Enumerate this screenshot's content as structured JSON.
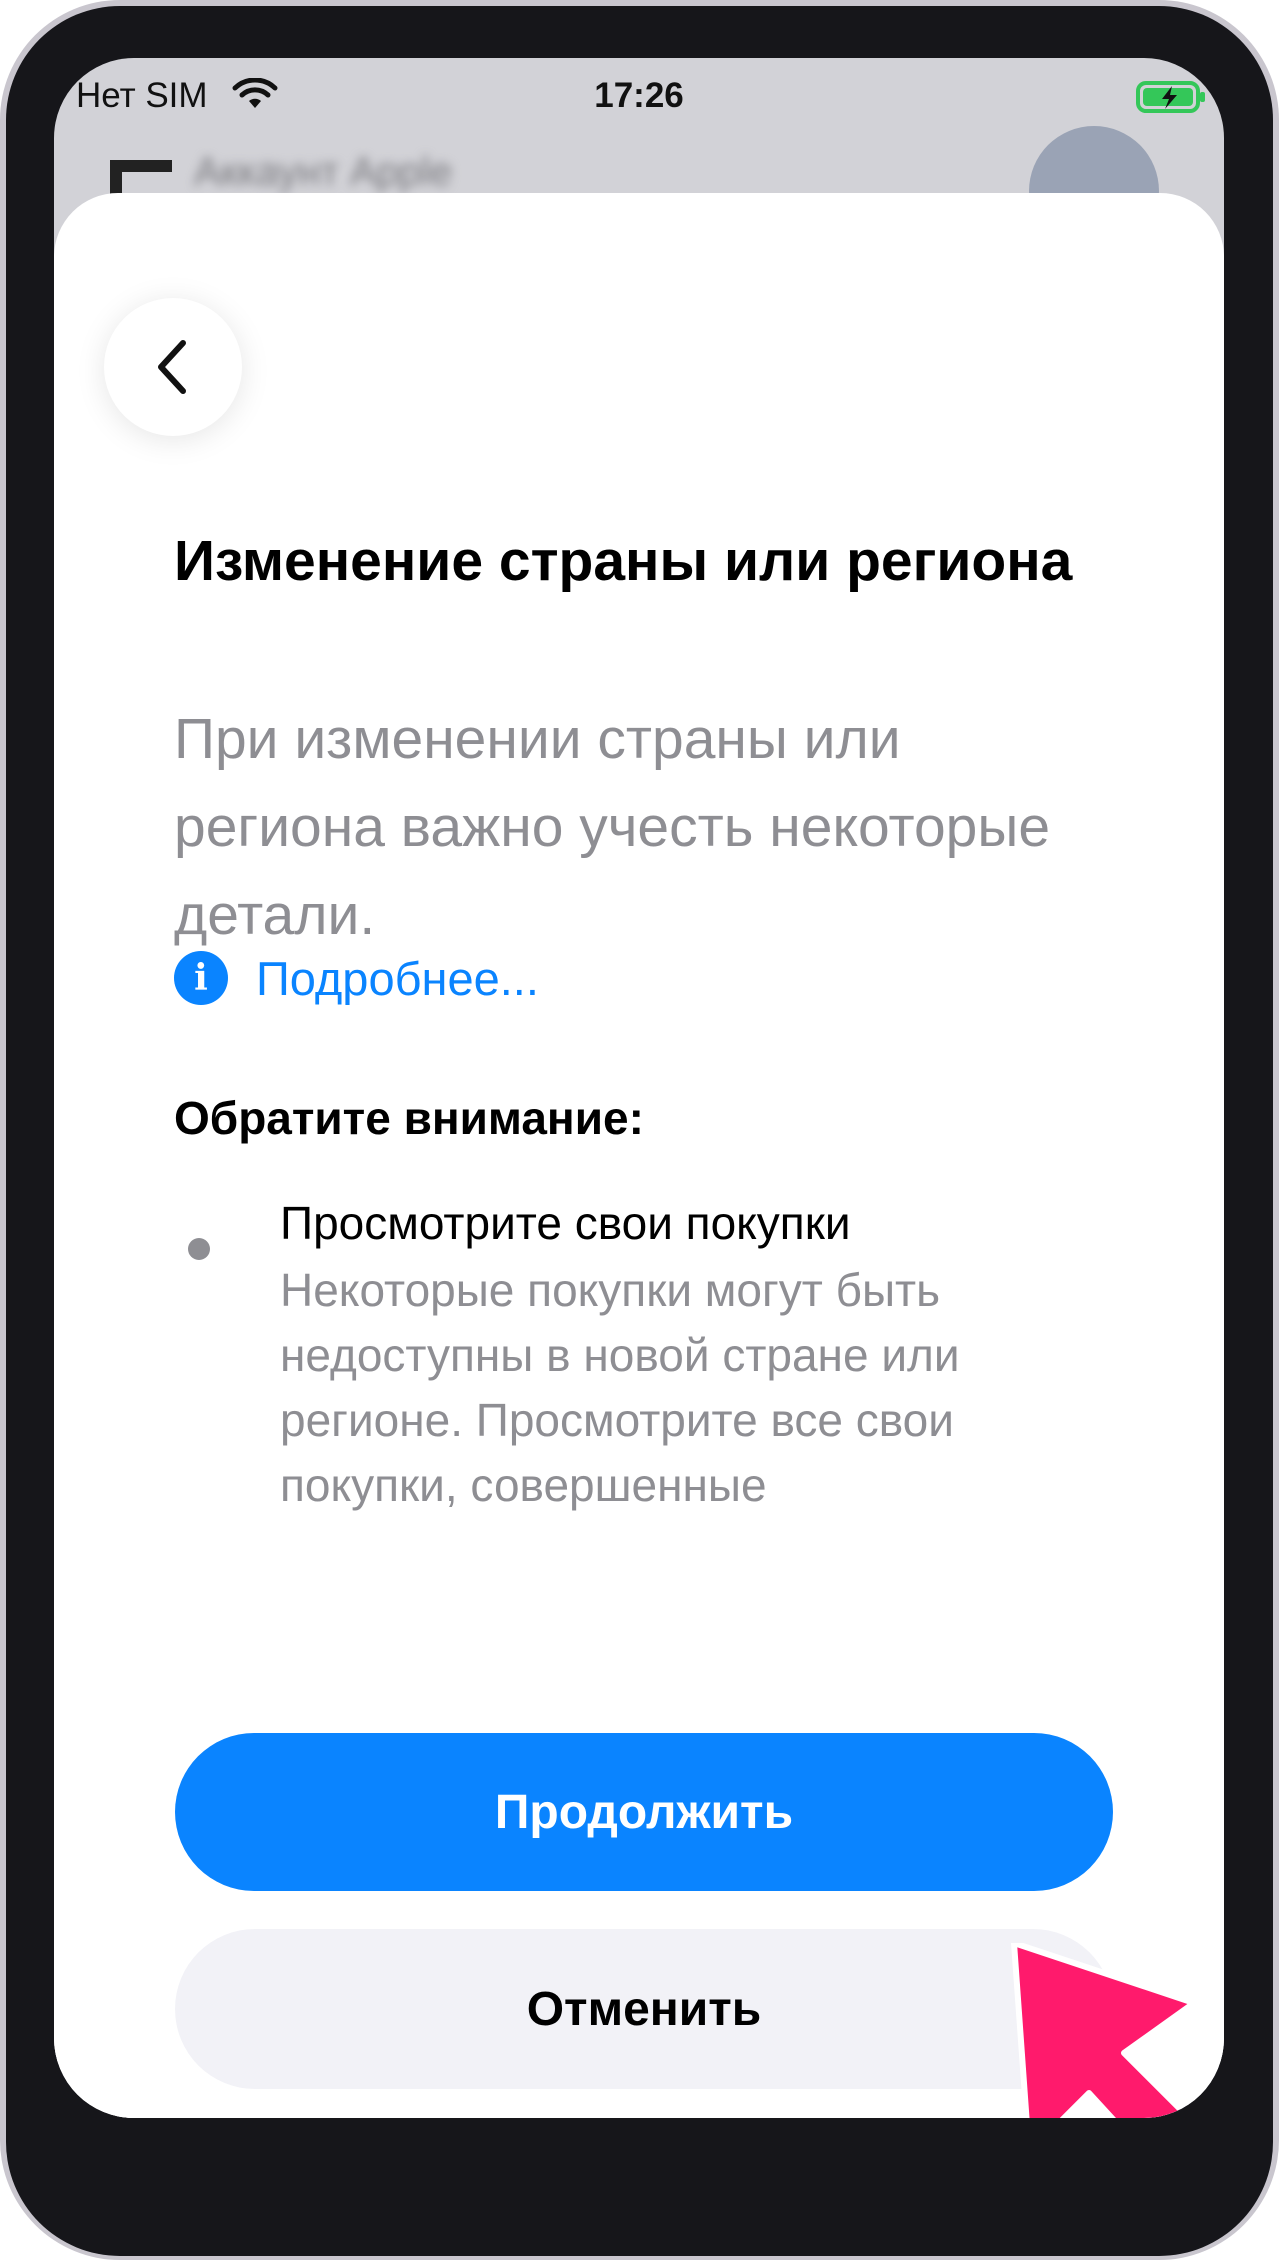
{
  "status_bar": {
    "carrier": "Нет SIM",
    "time": "17:26",
    "battery": "charging"
  },
  "background": {
    "title": "Аккаунт Apple"
  },
  "sheet": {
    "back_icon": "chevron-left-icon",
    "title": "Изменение страны или региона",
    "subtitle": "При изменении страны или региона важно учесть некоторые детали.",
    "more_link": "Подробнее...",
    "notice_heading": "Обратите внимание:",
    "bullet_title": "Просмотрите свои покупки",
    "bullet_text": "Некоторые покупки могут быть недоступны в новой стране или регионе. Просмотрите все свои покупки, совершенные"
  },
  "buttons": {
    "continue": "Продолжить",
    "cancel": "Отменить"
  },
  "colors": {
    "accent": "#0a84ff",
    "pointer": "#ff1a6c"
  }
}
